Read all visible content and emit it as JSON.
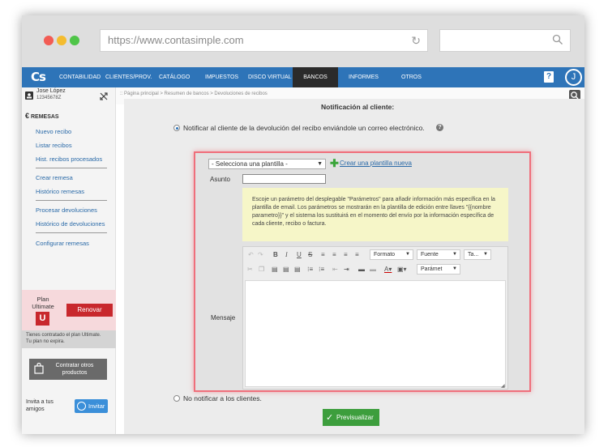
{
  "browser": {
    "url": "https://www.contasimple.com"
  },
  "topnav": {
    "logo": "Cs",
    "items": [
      "CONTABILIDAD",
      "CLIENTES/PROV.",
      "CATÁLOGO",
      "IMPUESTOS",
      "DISCO VIRTUAL",
      "BANCOS",
      "INFORMES",
      "OTROS"
    ],
    "active": "BANCOS",
    "help": "?",
    "avatar": "J"
  },
  "user": {
    "name": "Jose López",
    "id": "12345678Z"
  },
  "sidebar": {
    "section_title": "REMESAS",
    "links": [
      "Nuevo recibo",
      "Listar recibos",
      "Hist. recibos procesados",
      "Crear remesa",
      "Histórico remesas",
      "Procesar devoluciones",
      "Histórico de devoluciones",
      "Configurar remesas"
    ],
    "plan_label_1": "Plan",
    "plan_label_2": "Ultimate",
    "plan_badge": "U",
    "renovar": "Renovar",
    "plan_info_1": "Tienes contratado el plan Ultimate.",
    "plan_info_2": "Tu plan no expira.",
    "contratar_1": "Contratar otros",
    "contratar_2": "productos",
    "invita_1": "Invita a tus",
    "invita_2": "amigos",
    "invitar": "Invitar"
  },
  "breadcrumb": ":: Página principal > Resumen de bancos > Devoluciones de recibos",
  "main": {
    "notif_title": "Notificación al cliente:",
    "option_notify": "Notificar al cliente de la devolución del recibo enviándole un correo electrónico.",
    "option_no_notify": "No notificar a los clientes.",
    "template_select": "- Selecciona una plantilla -",
    "create_template": "Crear una plantilla nueva",
    "asunto_label": "Asunto",
    "hint": "Escoje un parámetro del desplegable \"Parámetros\" para añadir información más específica en la plantilla de email. Los parámetros se mostrarán en la plantilla de edición entre llaves \"{{nombre parametro}}\" y el sistema los sustituirá en el momento del envío por la información específica de cada cliente, recibo o factura.",
    "mensaje_label": "Mensaje",
    "toolbar": {
      "formato": "Formato",
      "fuente": "Fuente",
      "tamano": "Ta...",
      "parametros": "Parámet"
    },
    "preview_button": "Previsualizar"
  },
  "colors": {
    "nav_blue": "#2e74b8",
    "panel_highlight": "#ef6f7b",
    "renovar_red": "#c8282d",
    "preview_green": "#3d9e3d"
  }
}
